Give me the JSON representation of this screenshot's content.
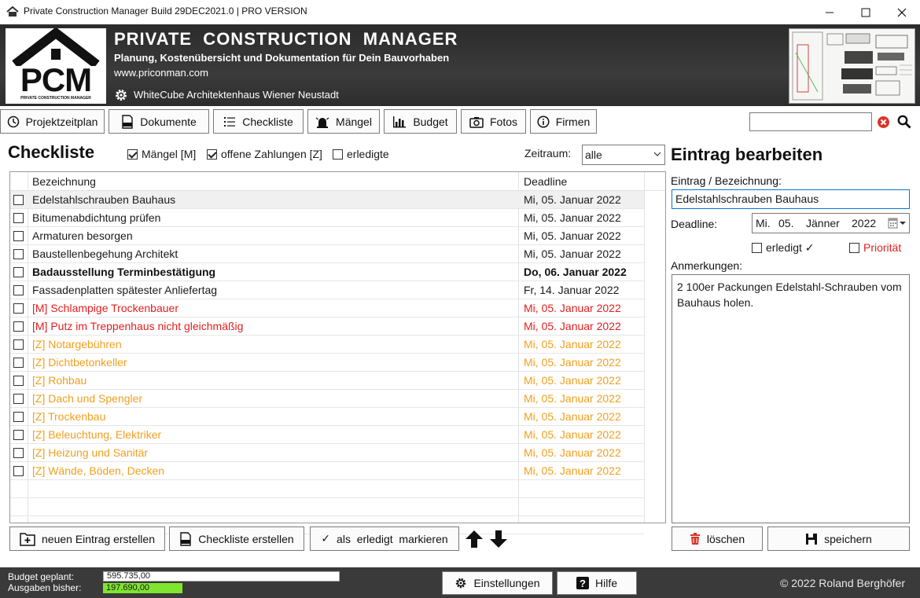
{
  "window": {
    "title": "Private Construction Manager Build 29DEC2021.0 | PRO VERSION"
  },
  "header": {
    "logo_text": "PCM",
    "logo_subtext": "PRIVATE CONSTRUCTION MANAGER",
    "app_title": "PRIVATE  CONSTRUCTION  MANAGER",
    "subtitle": "Planung, Kostenübersicht und Dokumentation für Dein Bauvorhaben",
    "url": "www.priconman.com",
    "project": "WhiteCube Architektenhaus Wiener Neustadt"
  },
  "nav": {
    "items": [
      {
        "label": "Projektzeitplan"
      },
      {
        "label": "Dokumente"
      },
      {
        "label": "Checkliste"
      },
      {
        "label": "Mängel"
      },
      {
        "label": "Budget"
      },
      {
        "label": "Fotos"
      },
      {
        "label": "Firmen"
      }
    ],
    "search_value": ""
  },
  "checklist": {
    "title": "Checkliste",
    "filters": [
      {
        "label": "Mängel [M]",
        "checked": true
      },
      {
        "label": "offene Zahlungen [Z]",
        "checked": true
      },
      {
        "label": "erledigte",
        "checked": false
      }
    ],
    "zeitraum_label": "Zeitraum:",
    "zeitraum_value": "alle",
    "columns": [
      "Bezeichnung",
      "Deadline"
    ],
    "rows": [
      {
        "name": "Edelstahlschrauben Bauhaus",
        "deadline": "Mi, 05. Januar 2022",
        "style": "normal",
        "selected": true
      },
      {
        "name": "Bitumenabdichtung prüfen",
        "deadline": "Mi, 05. Januar 2022",
        "style": "normal"
      },
      {
        "name": "Armaturen besorgen",
        "deadline": "Mi, 05. Januar 2022",
        "style": "normal"
      },
      {
        "name": "Baustellenbegehung Architekt",
        "deadline": "Mi, 05. Januar 2022",
        "style": "normal"
      },
      {
        "name": "Badausstellung Terminbestätigung",
        "deadline": "Do, 06. Januar 2022",
        "style": "bold"
      },
      {
        "name": "Fassadenplatten spätester Anliefertag",
        "deadline": "Fr, 14. Januar 2022",
        "style": "normal"
      },
      {
        "name": "[M] Schlampige Trockenbauer",
        "deadline": "Mi, 05. Januar 2022",
        "style": "red"
      },
      {
        "name": "[M] Putz im Treppenhaus nicht gleichmäßig",
        "deadline": "Mi, 05. Januar 2022",
        "style": "red"
      },
      {
        "name": "[Z] Notargebühren",
        "deadline": "Mi, 05. Januar 2022",
        "style": "orange"
      },
      {
        "name": "[Z] Dichtbetonkeller",
        "deadline": "Mi, 05. Januar 2022",
        "style": "orange"
      },
      {
        "name": "[Z] Rohbau",
        "deadline": "Mi, 05. Januar 2022",
        "style": "orange"
      },
      {
        "name": "[Z] Dach und Spengler",
        "deadline": "Mi, 05. Januar 2022",
        "style": "orange"
      },
      {
        "name": "[Z] Trockenbau",
        "deadline": "Mi, 05. Januar 2022",
        "style": "orange"
      },
      {
        "name": "[Z] Beleuchtung, Elektriker",
        "deadline": "Mi, 05. Januar 2022",
        "style": "orange"
      },
      {
        "name": "[Z] Heizung und Sanitär",
        "deadline": "Mi, 05. Januar 2022",
        "style": "orange"
      },
      {
        "name": "[Z] Wände, Böden, Decken",
        "deadline": "Mi, 05. Januar 2022",
        "style": "orange"
      }
    ],
    "buttons": {
      "new_entry": "neuen Eintrag erstellen",
      "create_checklist": "Checkliste erstellen",
      "mark_done": "als  erledigt  markieren"
    }
  },
  "editor": {
    "title": "Eintrag bearbeiten",
    "entry_label": "Eintrag / Bezeichnung:",
    "entry_value": "Edelstahlschrauben Bauhaus",
    "deadline_label": "Deadline:",
    "deadline_weekday": "Mi.",
    "deadline_day": "05.",
    "deadline_month": "Jänner",
    "deadline_year": "2022",
    "done_label": "erledigt ✓",
    "done_checked": false,
    "priority_label": "Priorität",
    "priority_checked": false,
    "notes_label": "Anmerkungen:",
    "notes_value": "2 100er Packungen Edelstahl-Schrauben vom Bauhaus holen.",
    "delete_label": "löschen",
    "save_label": "speichern"
  },
  "status": {
    "budget_label": "Budget  geplant:",
    "budget_value": "595.735,00",
    "spent_label": "Ausgaben bisher:",
    "spent_value": "197.690,00",
    "settings_label": "Einstellungen",
    "help_label": "Hilfe",
    "copyright": "© 2022 Roland Berghöfer"
  },
  "colors": {
    "red_item": "#e0201f",
    "orange_item": "#f0a020",
    "spent_bar": "#7fe52f",
    "header_bg": "#333333"
  }
}
